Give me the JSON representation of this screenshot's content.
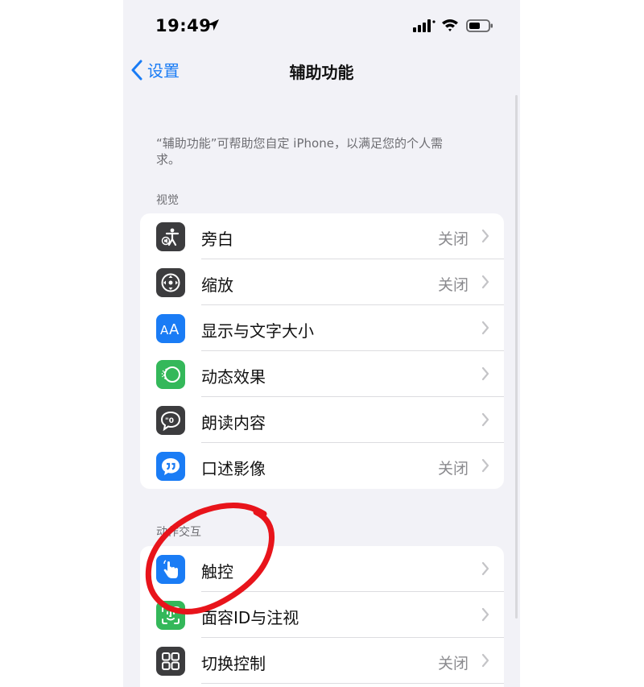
{
  "status": {
    "time": "19:49"
  },
  "nav": {
    "back_label": "设置",
    "title": "辅助功能"
  },
  "description": "“辅助功能”可帮助您自定 iPhone，以满足您的个人需求。",
  "sections": [
    {
      "header": "视觉",
      "items": [
        {
          "label": "旁白",
          "value": "关闭",
          "icon": "voiceover-icon",
          "color": "#3c3c3e"
        },
        {
          "label": "缩放",
          "value": "关闭",
          "icon": "zoom-icon",
          "color": "#3c3c3e"
        },
        {
          "label": "显示与文字大小",
          "value": "",
          "icon": "text-size-icon",
          "color": "#1a7cf5"
        },
        {
          "label": "动态效果",
          "value": "",
          "icon": "motion-icon",
          "color": "#34b85a"
        },
        {
          "label": "朗读内容",
          "value": "",
          "icon": "spoken-content-icon",
          "color": "#3c3c3e"
        },
        {
          "label": "口述影像",
          "value": "关闭",
          "icon": "audio-description-icon",
          "color": "#1a7cf5"
        }
      ]
    },
    {
      "header": "动作交互",
      "items": [
        {
          "label": "触控",
          "value": "",
          "icon": "touch-icon",
          "color": "#1a7cf5"
        },
        {
          "label": "面容ID与注视",
          "value": "",
          "icon": "face-id-icon",
          "color": "#34b85a"
        },
        {
          "label": "切换控制",
          "value": "关闭",
          "icon": "switch-control-icon",
          "color": "#3c3c3e"
        }
      ]
    }
  ],
  "colors": {
    "accent": "#1a7cf5",
    "annotation": "#e8141b",
    "background": "#f2f2f7"
  }
}
